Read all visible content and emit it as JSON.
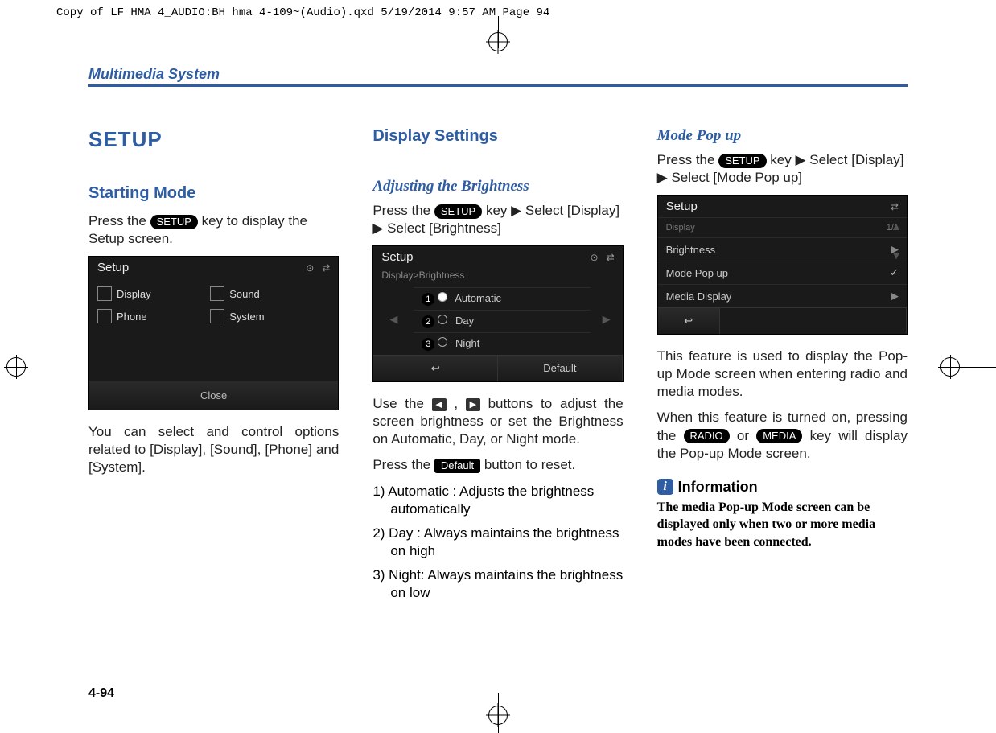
{
  "print_header": "Copy of LF HMA 4_AUDIO:BH hma 4-109~(Audio).qxd  5/19/2014  9:57 AM  Page 94",
  "section_header": "Multimedia System",
  "page_number": "4-94",
  "col1": {
    "title": "SETUP",
    "h2": "Starting Mode",
    "p1a": "Press the ",
    "setup_pill": "SETUP",
    "p1b": " key to display the Setup screen.",
    "shot": {
      "title": "Setup",
      "items": [
        "Display",
        "Sound",
        "Phone",
        "System"
      ],
      "close": "Close"
    },
    "p2": "You can select and control options related to [Display], [Sound], [Phone] and [System]."
  },
  "col2": {
    "h2": "Display Settings",
    "h3": "Adjusting the Brightness",
    "p1a": "Press the ",
    "setup_pill": "SETUP",
    "p1b": " key ▶ Select [Display] ▶ Select [Brightness]",
    "shot": {
      "title": "Setup",
      "breadcrumb": "Display>Brightness",
      "options": [
        "Automatic",
        "Day",
        "Night"
      ],
      "back": "↩",
      "default": "Default"
    },
    "p2a": "Use the ",
    "p2b": ", ",
    "p2c": " buttons to adjust the screen brightness or set the Brightness on Automatic, Day, or Night mode.",
    "p3a": "Press the ",
    "default_pill": "Default",
    "p3b": " button to reset.",
    "list": [
      "1) Automatic : Adjusts the brightness automatically",
      "2) Day : Always maintains the brightness on high",
      "3) Night: Always maintains the brightness on low"
    ]
  },
  "col3": {
    "h3": "Mode Pop up",
    "p1a": "Press the ",
    "setup_pill": "SETUP",
    "p1b": " key ▶ Select [Display] ▶ Select [Mode Pop up]",
    "shot": {
      "title": "Setup",
      "header_right": "1/1",
      "header_left": "Display",
      "rows": [
        {
          "label": "Brightness",
          "indicator": "▶"
        },
        {
          "label": "Mode Pop up",
          "indicator": "✓"
        },
        {
          "label": "Media Display",
          "indicator": "▶"
        }
      ],
      "back": "↩"
    },
    "p2": "This feature is used to display the Pop-up Mode screen when entering radio and media modes.",
    "p3a": "When this feature is turned on, pressing the ",
    "radio_pill": "RADIO",
    "p3b": " or ",
    "media_pill": "MEDIA",
    "p3c": " key will display the Pop-up Mode screen.",
    "info_title": "Information",
    "info_body": "The media Pop-up Mode screen can be displayed only when two or more media modes have been connected."
  }
}
